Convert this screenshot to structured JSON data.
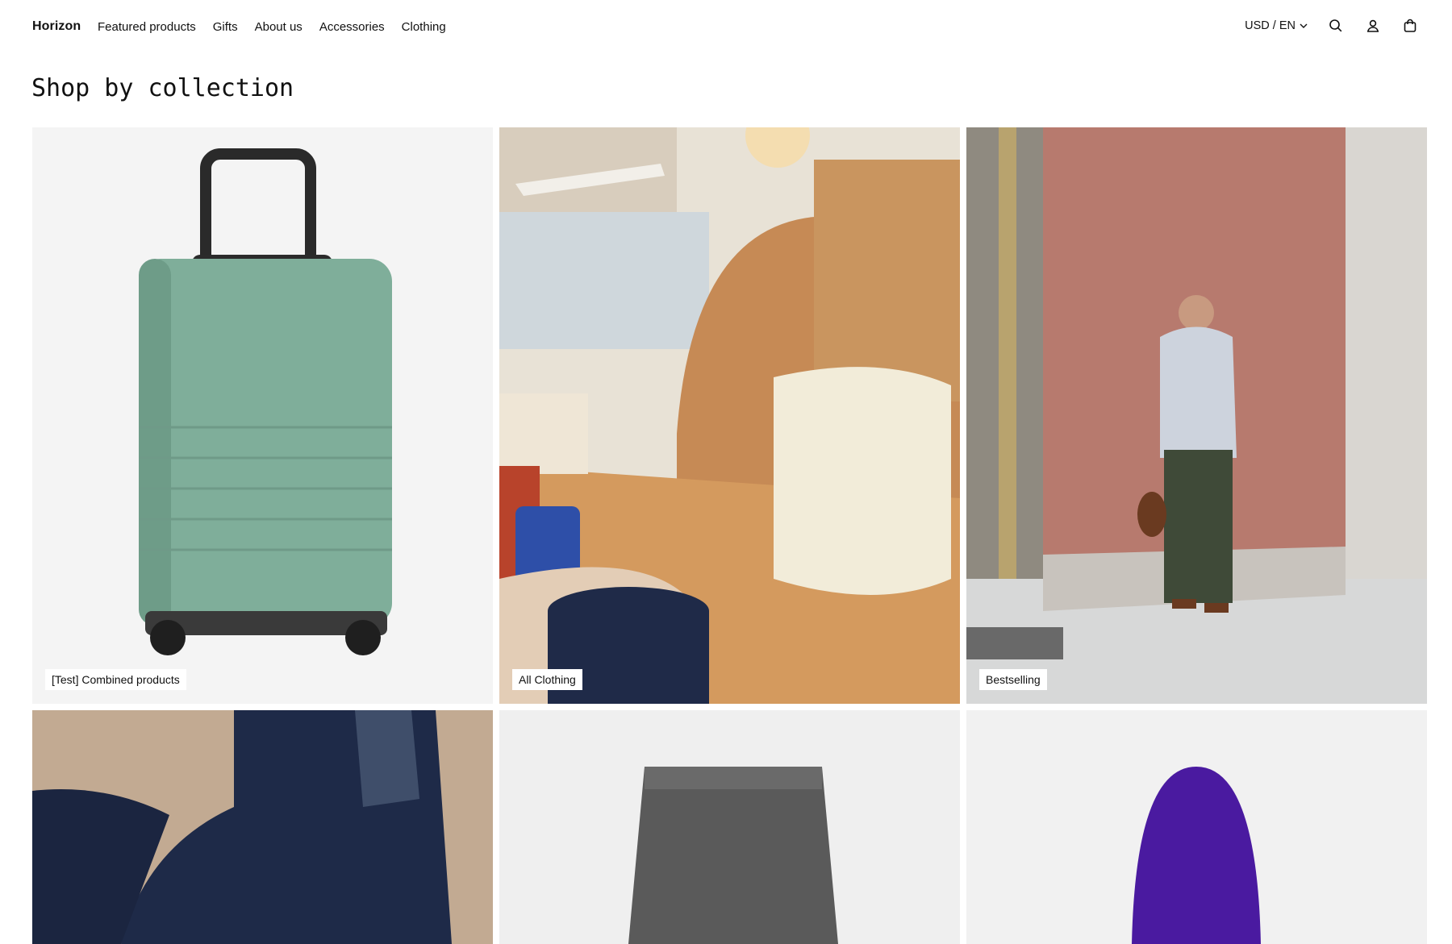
{
  "brand": "Horizon",
  "nav": [
    "Featured products",
    "Gifts",
    "About us",
    "Accessories",
    "Clothing"
  ],
  "header": {
    "locale": "USD / EN",
    "icons": [
      "search-icon",
      "account-icon",
      "cart-icon"
    ]
  },
  "page_title": "Shop by collection",
  "collections": [
    {
      "label": "[Test] Combined products",
      "image": "green-suitcase"
    },
    {
      "label": "All Clothing",
      "image": "store-interior"
    },
    {
      "label": "Bestselling",
      "image": "man-against-wall"
    },
    {
      "label": "",
      "image": "person-in-navy-shirt"
    },
    {
      "label": "",
      "image": "grey-shorts"
    },
    {
      "label": "",
      "image": "purple-beanie"
    }
  ],
  "colors": {
    "text": "#111111",
    "card_bg": "#f4f4f4",
    "accent_suitcase": "#7fae9a"
  }
}
